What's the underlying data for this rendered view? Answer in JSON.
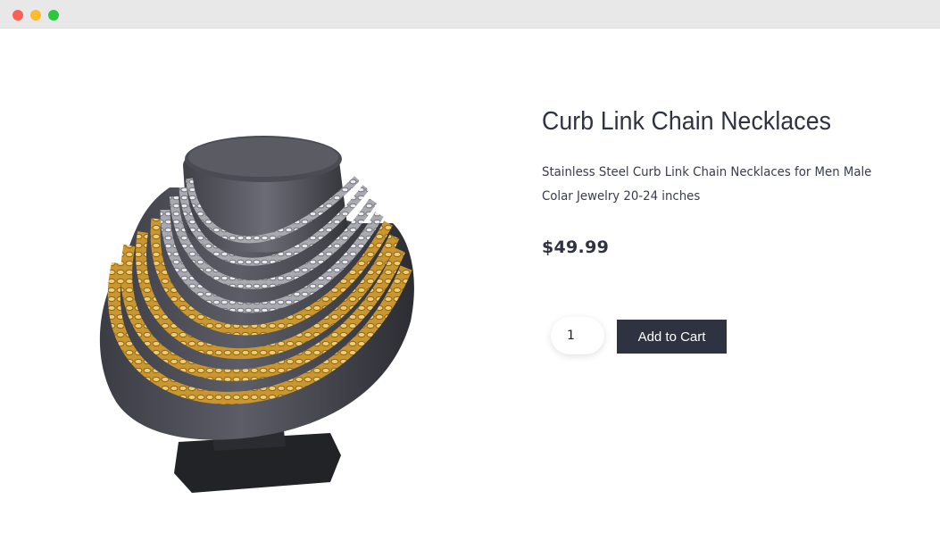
{
  "window": {
    "controls": {
      "close_color": "#fe5f57",
      "minimize_color": "#febc2e",
      "maximize_color": "#28c840"
    }
  },
  "product": {
    "image_icon": "necklace-bust-image",
    "title": "Curb Link Chain Necklaces",
    "description": "Stainless Steel Curb Link Chain Necklaces for Men Male Colar Jewelry 20-24 inches",
    "price": "$49.99",
    "quantity": "1",
    "add_to_cart_label": "Add to Cart"
  },
  "colors": {
    "primary": "#2f3240",
    "gold": "#d4a43a",
    "silver": "#c8c8cc"
  }
}
